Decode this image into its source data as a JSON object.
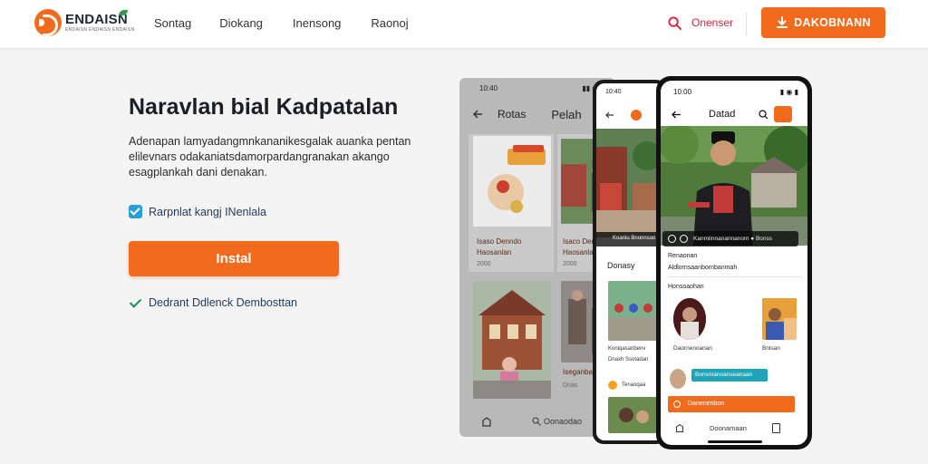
{
  "nav": {
    "brand": "ENDAISN",
    "brand_tagline": "ENDAISN ENDAISN ENDAISN",
    "links": [
      "Sontag",
      "Diokang",
      "Inensong",
      "Raonoj"
    ],
    "search_label": "Onenser",
    "download_label": "DAKOBNANN"
  },
  "hero": {
    "title": "Naravlan bial Kadpatalan",
    "description": "Adenapan lamyadangmnkananikesgalak auanka pentan elilevnars odakaniatsdamorpardangranakan akango esagplankah dani denakan.",
    "checkbox_label": "Rarpnlat kangj INenlala",
    "install_label": "Instal",
    "verified_label": "Dedrant Ddlenck Dembosttan"
  },
  "phone1": {
    "time": "10:40",
    "status_right": "▮▮ ◉ ▮",
    "tab1": "Rotas",
    "tab2": "Pelah",
    "card1_title": "Isaso Denndo",
    "card1_sub": "Haosanlan",
    "card1_meta": "2000",
    "card2_title": "Isaco Denao",
    "card2_sub": "Haosanlan",
    "card2_meta": "2000",
    "card3_title": "Iseganbab",
    "card3_meta": "Dnas",
    "bottom_label": "Oonaodao"
  },
  "phone2": {
    "time": "10:40",
    "chip": "Koaniu Bnonnsoo",
    "section": "Donasy",
    "caption1": "Koniqasanbenv",
    "caption2": "Dnaxh Ssotadan",
    "caption3": "Tenaoqaa"
  },
  "phone3": {
    "time": "10:00",
    "status_right": "▮ ◉ ▮",
    "title": "Datad",
    "chip": "Kanmiinnanannanom  ● Bonss",
    "section1": "Renaonan",
    "section1_sub": "Aldlornsaanbornbanmah",
    "section2": "Honsoaohan",
    "caption_left": "Daornenoanan",
    "caption_right": "Bnlsan",
    "tag": "Bonsmanoanseanaan",
    "orange_bar": "Danenenbon",
    "bottom_label": "Doonamaan"
  },
  "colors": {
    "accent": "#f26b1d",
    "link_red": "#d7263d",
    "checkbox_blue": "#2a9fd6",
    "verified_green": "#1f8a5a",
    "teal_tag": "#1fa4b8"
  },
  "icons": [
    "logo-icon",
    "search-icon",
    "download-icon",
    "checkbox-icon",
    "check-icon",
    "back-arrow-icon",
    "home-icon",
    "book-icon"
  ]
}
